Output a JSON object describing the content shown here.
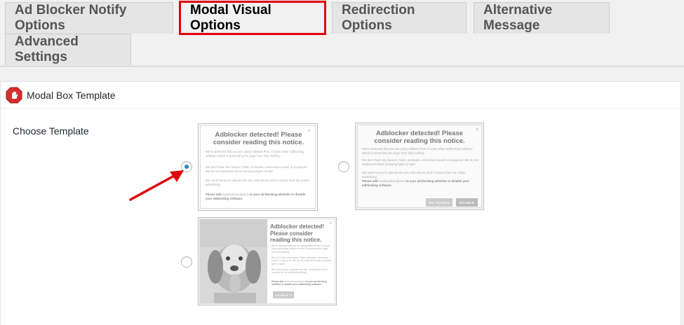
{
  "tabs": [
    {
      "label": "Ad Blocker Notify Options",
      "active": false
    },
    {
      "label": "Modal Visual Options",
      "active": true
    },
    {
      "label": "Redirection Options",
      "active": false
    },
    {
      "label": "Alternative Message",
      "active": false
    },
    {
      "label": "Advanced Settings",
      "active": false
    }
  ],
  "panel": {
    "title": "Modal Box Template",
    "icon": "stop-hand-icon",
    "choose_label": "Choose Template"
  },
  "templates": {
    "selected": 1,
    "t1": {
      "heading": "Adblocker detected! Please consider reading this notice.",
      "p1": "We've detected that you are using AdBlock Plus or some other adblocking software which is preventing the page from fully loading.",
      "p2": "We don't have any banner, Flash, animation, obnoxious sound, or popup ad. We do not implement these annoying types of ads!",
      "p3": "We need money to operate the site, and almost all of it comes from our online advertising.",
      "p4_strong": "Please add",
      "p4_link": "localhost/wordpress",
      "p4_rest": "to your ad blocking whitelist or disable your adblocking software."
    },
    "t2": {
      "heading": "Adblocker detected! Please consider reading this notice.",
      "p1": "We've detected that you are using AdBlock Plus or some other adblocking software which is preventing the page from fully loading.",
      "p2": "We don't have any banner, Flash, animation, obnoxious sound, or popup ad. We do not implement these annoying types of ads!",
      "p3": "We need money to operate the site, and almost all of it comes from our online advertising.",
      "p4_strong": "Please add",
      "p4_link": "localhost/wordpress",
      "p4_rest": "to your ad blocking whitelist or disable your adblocking software.",
      "btn_no": "NO THANKS",
      "btn_disable": "DISABLE"
    },
    "t3": {
      "heading": "Adblocker detected! Please consider reading this notice.",
      "p1": "We've detected that you are using AdBlock Plus or some other adblocking software which is preventing the page from fully loading.",
      "p2": "We don't have any banner, Flash, animation, obnoxious sound, or popup ad. We do not implement these annoying types of ads!",
      "p3": "We need money to operate the site, and almost all of it comes from our online advertising.",
      "p4_strong": "Please add",
      "p4_link": "localhost/wordpress",
      "p4_rest": "to your ad blocking whitelist or disable your adblocking software.",
      "btn_disable": "DISABLE IT"
    }
  },
  "colors": {
    "tab_highlight": "#e0000b",
    "arrow": "#e0000b",
    "radio_checked": "#1e8cbe"
  }
}
